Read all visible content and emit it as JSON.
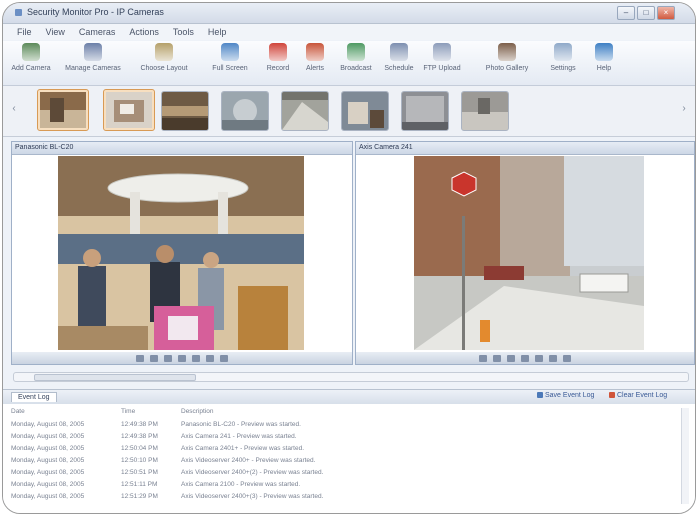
{
  "window": {
    "title": "Security Monitor Pro - IP Cameras",
    "controls": [
      "–",
      "□",
      "×"
    ]
  },
  "menu": [
    "File",
    "View",
    "Cameras",
    "Actions",
    "Tools",
    "Help"
  ],
  "toolbar": [
    {
      "label": "Add Camera",
      "icon": "camera-add-icon",
      "color": "#5c8a5a"
    },
    {
      "label": "Manage Cameras",
      "icon": "manage-cameras-icon",
      "color": "#6b7fa8"
    },
    {
      "label": "Choose Layout",
      "icon": "layout-icon",
      "color": "#b5a06a"
    },
    {
      "label": "Full Screen",
      "icon": "fullscreen-icon",
      "color": "#4f86c6"
    },
    {
      "label": "Record",
      "icon": "record-icon",
      "color": "#d0453b"
    },
    {
      "label": "Alerts",
      "icon": "alerts-icon",
      "color": "#c8553a"
    },
    {
      "label": "Broadcast",
      "icon": "broadcast-icon",
      "color": "#4f9a63"
    },
    {
      "label": "Schedule",
      "icon": "schedule-icon",
      "color": "#7d8fb0"
    },
    {
      "label": "FTP Upload",
      "icon": "ftp-upload-icon",
      "color": "#8c9cba"
    },
    {
      "label": "Photo Gallery",
      "icon": "photo-gallery-icon",
      "color": "#7c5f4a"
    },
    {
      "label": "Settings",
      "icon": "settings-icon",
      "color": "#8fa9c9"
    },
    {
      "label": "Help",
      "icon": "help-icon",
      "color": "#3e7fc4"
    }
  ],
  "thumbnails": [
    {
      "name": "camera-1",
      "colors": [
        "#8a6a4a",
        "#c9b598",
        "#5d4a38"
      ],
      "selected": true
    },
    {
      "name": "camera-2",
      "colors": [
        "#d9d2c8",
        "#a68e78",
        "#f0ece6"
      ],
      "selected": true
    },
    {
      "name": "camera-3",
      "colors": [
        "#6e5a44",
        "#b59a76",
        "#4a3b2c"
      ],
      "selected": false
    },
    {
      "name": "camera-4",
      "colors": [
        "#9ba6ae",
        "#c7cdd1",
        "#6f7a82"
      ],
      "selected": false
    },
    {
      "name": "camera-5",
      "colors": [
        "#a2a39c",
        "#d7d6cf",
        "#73736c"
      ],
      "selected": false
    },
    {
      "name": "camera-6",
      "colors": [
        "#7f8a96",
        "#d8d0c4",
        "#5c4a3a"
      ],
      "selected": false
    },
    {
      "name": "camera-7",
      "colors": [
        "#8d8f94",
        "#b6b7ba",
        "#5f6166"
      ],
      "selected": false
    },
    {
      "name": "camera-8",
      "colors": [
        "#9c9a96",
        "#c9c6c0",
        "#6a6864"
      ],
      "selected": false
    }
  ],
  "panes": [
    {
      "title": "Panasonic BL-C20"
    },
    {
      "title": "Axis Camera 241"
    }
  ],
  "eventlog": {
    "tab": "Event Log",
    "save_label": "Save Event Log",
    "clear_label": "Clear Event Log",
    "columns": [
      "Date",
      "Time",
      "Description"
    ],
    "rows": [
      [
        "Monday, August 08, 2005",
        "12:49:38 PM",
        "Panasonic BL-C20 - Preview was started."
      ],
      [
        "Monday, August 08, 2005",
        "12:49:38 PM",
        "Axis Camera 241 - Preview was started."
      ],
      [
        "Monday, August 08, 2005",
        "12:50:04 PM",
        "Axis Camera 2401+ - Preview was started."
      ],
      [
        "Monday, August 08, 2005",
        "12:50:10 PM",
        "Axis Videoserver 2400+ - Preview was started."
      ],
      [
        "Monday, August 08, 2005",
        "12:50:51 PM",
        "Axis Videoserver 2400+(2) - Preview was started."
      ],
      [
        "Monday, August 08, 2005",
        "12:51:11 PM",
        "Axis Camera 2100 - Preview was started."
      ],
      [
        "Monday, August 08, 2005",
        "12:51:29 PM",
        "Axis Videoserver 2400+(3) - Preview was started."
      ]
    ]
  }
}
